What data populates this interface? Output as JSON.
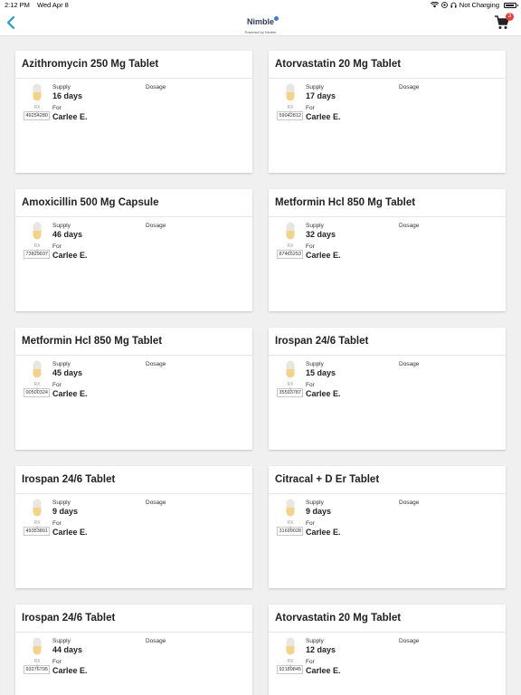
{
  "status_bar": {
    "time": "2:12 PM",
    "date": "Wed Apr 8",
    "charging": "Not Charging"
  },
  "header": {
    "brand": "Nimble",
    "powered_by": "Powered by Nimble",
    "cart_count": "3"
  },
  "labels": {
    "supply": "Supply",
    "dosage": "Dosage",
    "for": "For",
    "rx": "RX #"
  },
  "prescriptions": [
    {
      "name": "Azithromycin 250 Mg Tablet",
      "supply": "16 days",
      "rx": "49254280",
      "for": "Carlee E."
    },
    {
      "name": "Atorvastatin 20 Mg Tablet",
      "supply": "17 days",
      "rx": "59042812",
      "for": "Carlee E."
    },
    {
      "name": "Amoxicillin 500 Mg Capsule",
      "supply": "46 days",
      "rx": "73829037",
      "for": "Carlee E."
    },
    {
      "name": "Metformin Hcl 850 Mg Tablet",
      "supply": "32 days",
      "rx": "87465253",
      "for": "Carlee E."
    },
    {
      "name": "Metformin Hcl 850 Mg Tablet",
      "supply": "45 days",
      "rx": "00500324",
      "for": "Carlee E."
    },
    {
      "name": "Irospan 24/6 Tablet",
      "supply": "15 days",
      "rx": "35593787",
      "for": "Carlee E."
    },
    {
      "name": "Irospan 24/6 Tablet",
      "supply": "9 days",
      "rx": "49353891",
      "for": "Carlee E."
    },
    {
      "name": "Citracal + D Er Tablet",
      "supply": "9 days",
      "rx": "31699028",
      "for": "Carlee E."
    },
    {
      "name": "Irospan 24/6 Tablet",
      "supply": "44 days",
      "rx": "93276795",
      "for": "Carlee E."
    },
    {
      "name": "Atorvastatin 20 Mg Tablet",
      "supply": "12 days",
      "rx": "92189845",
      "for": "Carlee E."
    }
  ],
  "colors": {
    "accent": "#1aa0c8",
    "badge": "#e8413c",
    "pill_top": "#e9e6df",
    "pill_bottom": "#f3d28a"
  },
  "icons": {
    "back": "chevron-left-icon",
    "cart": "cart-icon",
    "pill": "capsule-icon",
    "wifi": "wifi-icon",
    "battery": "battery-icon"
  }
}
